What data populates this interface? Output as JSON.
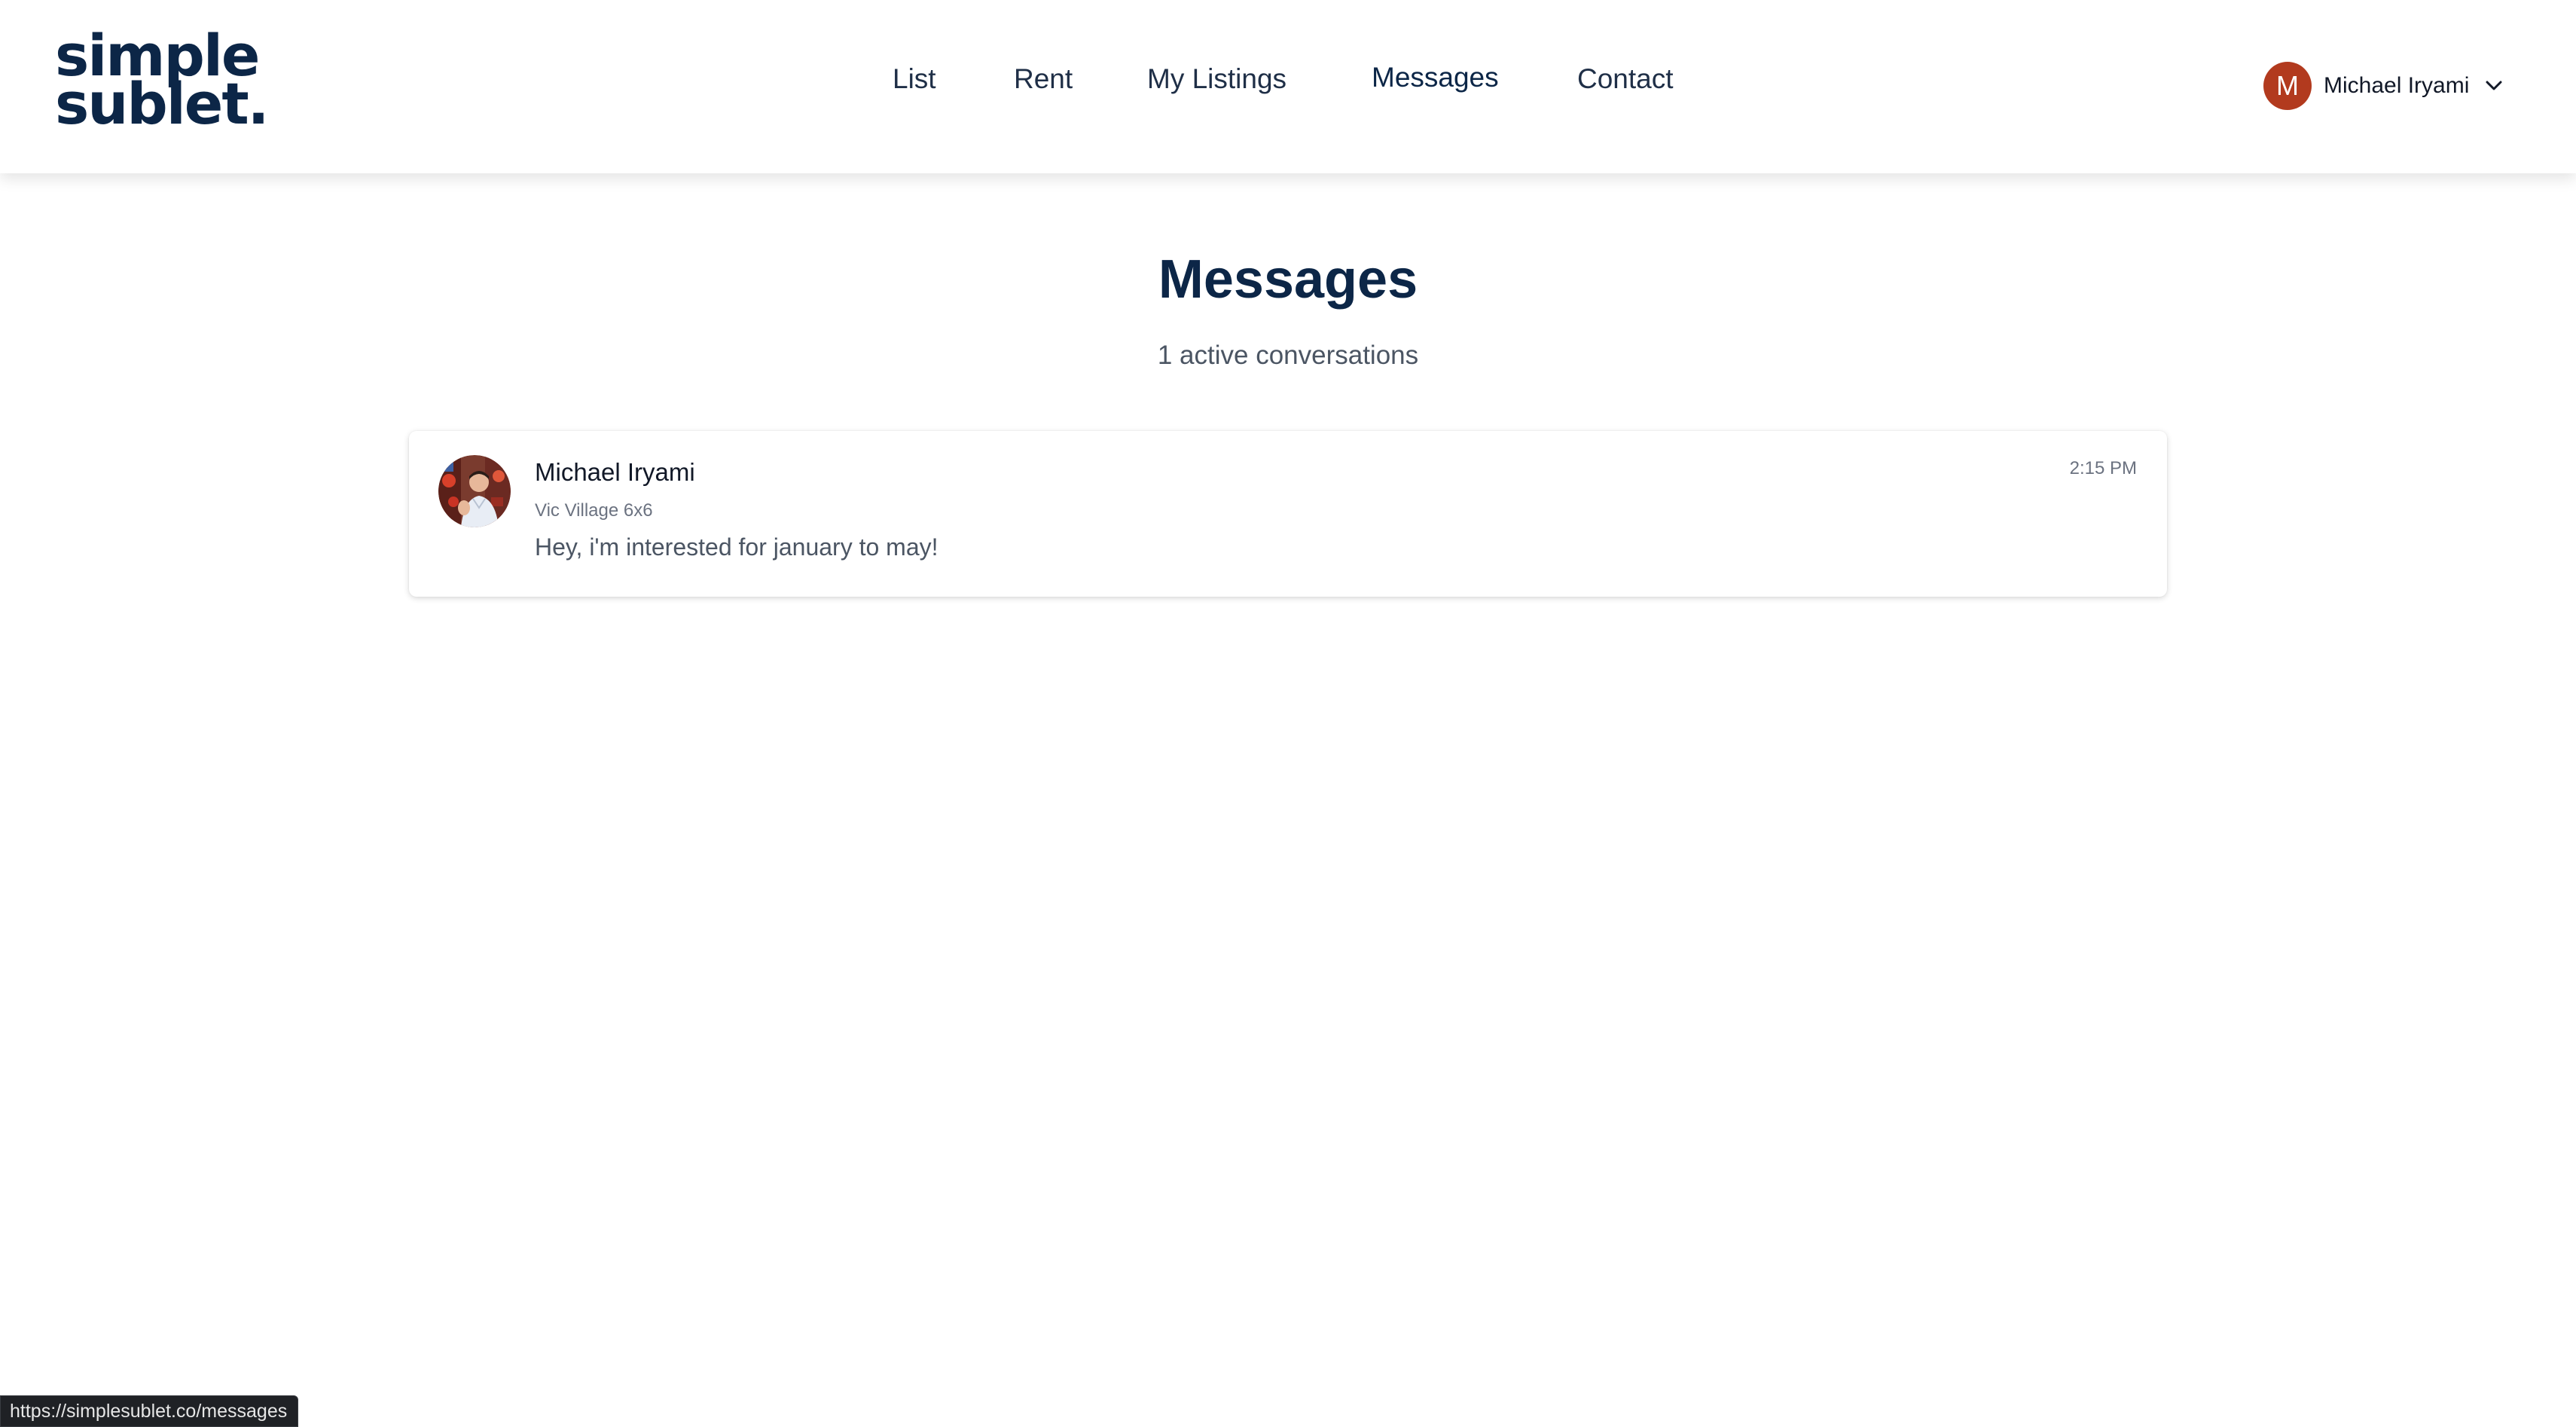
{
  "header": {
    "logo": {
      "line1": "simple",
      "line2": "sublet."
    },
    "nav": {
      "list": "List",
      "rent": "Rent",
      "my_listings": "My Listings",
      "messages": "Messages",
      "contact": "Contact",
      "active": "Messages"
    },
    "user": {
      "initial": "M",
      "name": "Michael Iryami",
      "avatar_color": "#b23a1e"
    }
  },
  "main": {
    "title": "Messages",
    "subtitle": "1 active conversations",
    "conversations": [
      {
        "name": "Michael Iryami",
        "listing": "Vic Village 6x6",
        "preview": "Hey, i'm interested for january to may!",
        "time": "2:15 PM",
        "avatar": "user-photo"
      }
    ]
  },
  "status_bar": {
    "url": "https://simplesublet.co/messages"
  },
  "colors": {
    "brand_navy": "#0c2647",
    "nav_text": "#1f2f47",
    "muted_text": "#6b7280"
  }
}
